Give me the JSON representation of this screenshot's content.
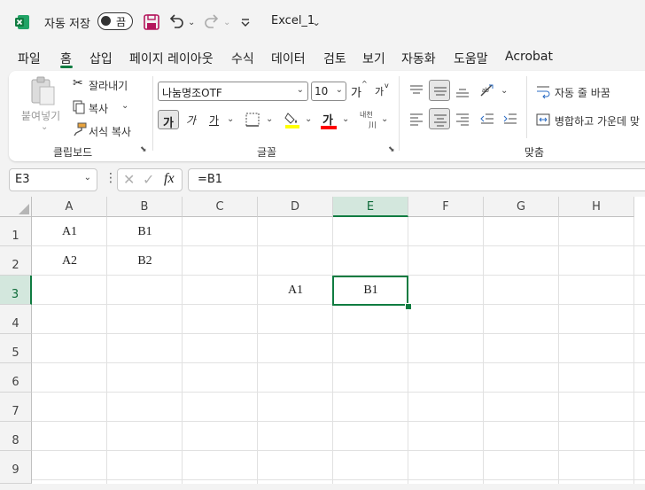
{
  "titlebar": {
    "autosave_label": "자동 저장",
    "autosave_state": "끔",
    "filename": "Excel_1",
    "icons": [
      "excel-logo",
      "save-icon",
      "undo-icon",
      "redo-icon",
      "customize-qat-icon"
    ]
  },
  "menu": {
    "items": [
      "파일",
      "홈",
      "삽입",
      "페이지 레이아웃",
      "수식",
      "데이터",
      "검토",
      "보기",
      "자동화",
      "도움말",
      "Acrobat"
    ],
    "active": "홈"
  },
  "ribbon": {
    "clipboard": {
      "paste": "붙여넣기",
      "cut": "잘라내기",
      "copy": "복사",
      "format_painter": "서식 복사",
      "group": "클립보드"
    },
    "font": {
      "font_name": "나눔명조OTF",
      "font_size": "10",
      "grow": "가",
      "shrink": "가",
      "bold": "가",
      "italic": "가",
      "underline": "가",
      "font_color": "가",
      "phonetic": "내천",
      "group": "글꼴"
    },
    "alignment": {
      "wrap_text": "자동 줄 바꿈",
      "merge_center": "병합하고 가운데 맞",
      "group": "맞춤"
    }
  },
  "formula_bar": {
    "name_box": "E3",
    "fx": "fx",
    "formula": "=B1"
  },
  "sheet": {
    "columns": [
      "A",
      "B",
      "C",
      "D",
      "E",
      "F",
      "G",
      "H"
    ],
    "rows": [
      "1",
      "2",
      "3",
      "4",
      "5",
      "6",
      "7",
      "8",
      "9"
    ],
    "selected_column": "E",
    "selected_row": "3",
    "cells": {
      "A1": "A1",
      "B1": "B1",
      "A2": "A2",
      "B2": "B2",
      "D3": "A1",
      "E3": "B1"
    }
  },
  "colors": {
    "accent": "#107c41",
    "highlight_yellow": "#ffff00",
    "font_red": "#ff0000"
  }
}
